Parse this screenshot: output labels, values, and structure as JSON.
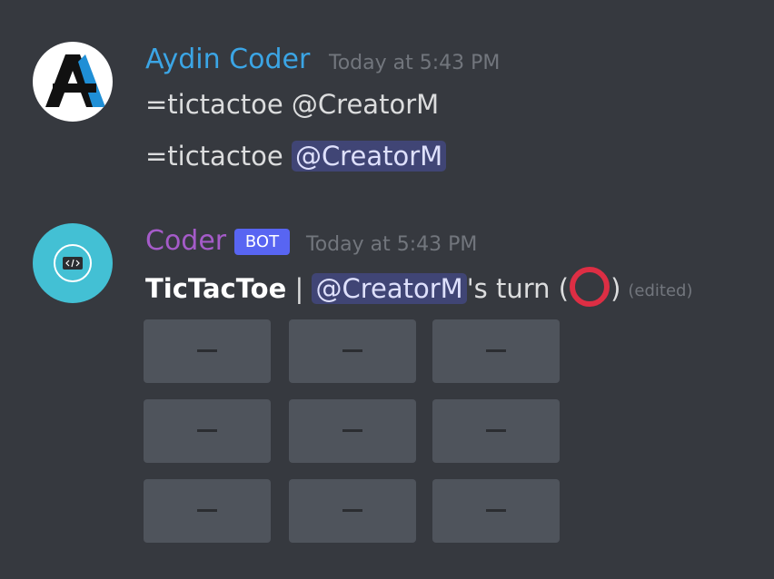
{
  "messages": [
    {
      "author": "Aydin Coder",
      "author_color": "#3ba5e5",
      "timestamp": "Today at 5:43 PM",
      "lines": [
        {
          "text": "=tictactoe @CreatorM"
        },
        {
          "prefix": "=tictactoe ",
          "mention": "@CreatorM"
        }
      ]
    },
    {
      "author": "Coder",
      "author_color": "#a55bc9",
      "bot_tag": "BOT",
      "timestamp": "Today at 5:43 PM",
      "title": "TicTacToe",
      "separator": " | ",
      "mention": "@CreatorM",
      "turn_text": "'s turn (",
      "turn_symbol": "red-circle-icon",
      "close_paren": ")",
      "edited": "(edited)",
      "board": [
        [
          "—",
          "—",
          "—"
        ],
        [
          "—",
          "—",
          "—"
        ],
        [
          "—",
          "—",
          "—"
        ]
      ]
    }
  ],
  "colors": {
    "background": "#36393f",
    "mention_text": "#dee0fc",
    "bot_tag": "#5865f2",
    "cell": "#4f545c",
    "turn_circle": "#dd2e44"
  }
}
